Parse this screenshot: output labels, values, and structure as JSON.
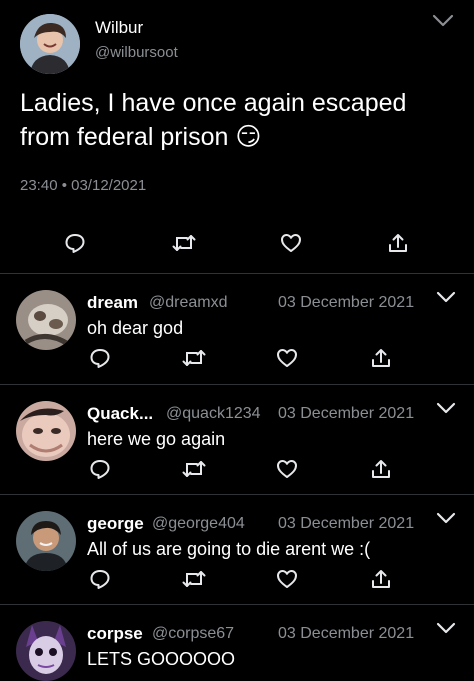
{
  "main_tweet": {
    "name": "Wilbur",
    "handle": "@wilbursoot",
    "text": "Ladies, I have once again escaped from federal prison 😏",
    "timestamp": "23:40 • 03/12/2021"
  },
  "replies": [
    {
      "name": "dream",
      "handle": "@dreamxd",
      "date": "03 December 2021",
      "text": "oh dear god",
      "avatar_color": "#9a8f86"
    },
    {
      "name": "Quack...",
      "handle": "@quack1234",
      "date": "03 December 2021",
      "text": "here we go again",
      "avatar_color": "#c9a9a0"
    },
    {
      "name": "george",
      "handle": "@george404",
      "date": "03 December 2021",
      "text": "All of us are going to die arent we :(",
      "avatar_color": "#5f6e74"
    },
    {
      "name": "corpse",
      "handle": "@corpse67",
      "date": "03 December 2021",
      "text": "LETS GOOOOOO",
      "avatar_color": "#3b2a4d"
    }
  ],
  "icons": {
    "reply": "reply-icon",
    "retweet": "retweet-icon",
    "like": "heart-icon",
    "share": "share-icon",
    "more": "chevron-down-icon"
  },
  "colors": {
    "background": "#000000",
    "text": "#ffffff",
    "secondary_text": "#8b8f94",
    "icon": "#e6e8eb",
    "divider": "#2f3336"
  }
}
